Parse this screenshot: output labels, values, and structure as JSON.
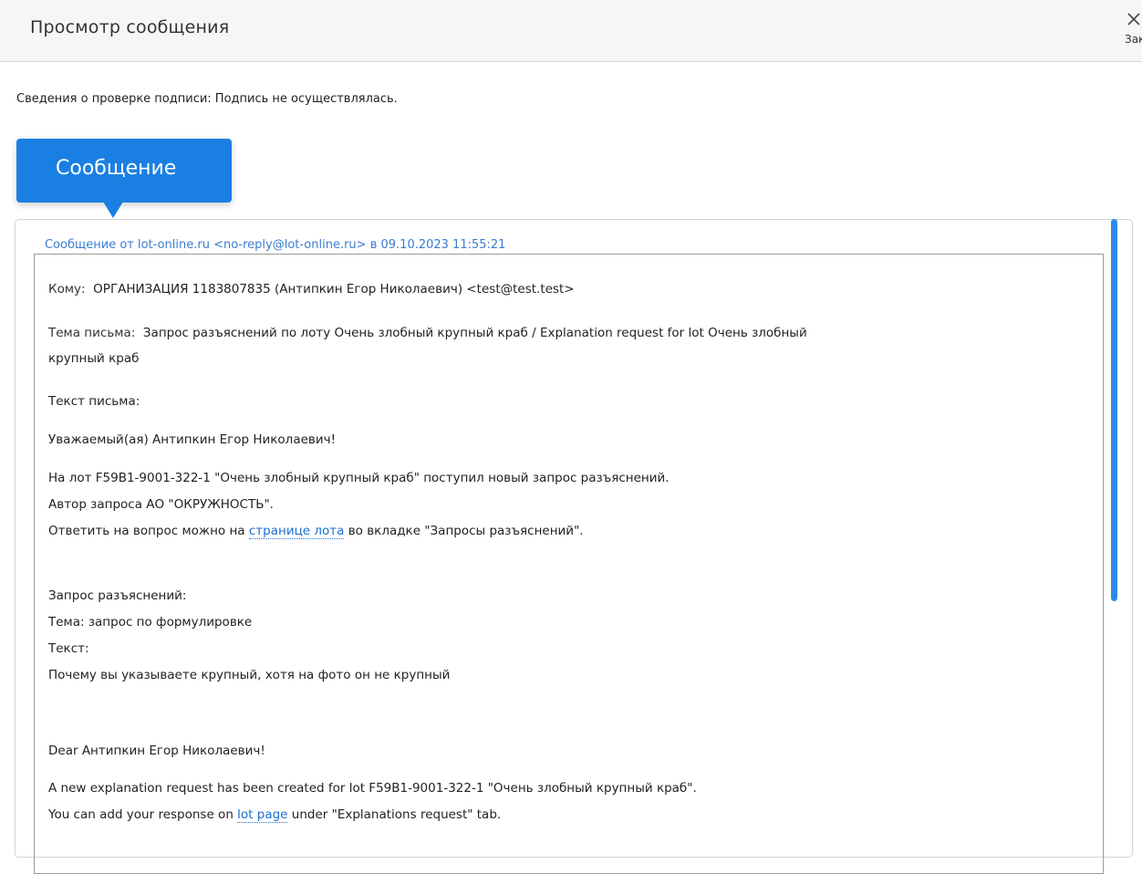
{
  "header": {
    "title": "Просмотр сообщения",
    "close_label": "Закрыть"
  },
  "signature_info": "Сведения о проверке подписи: Подпись не осуществлялась.",
  "tab": {
    "label": "Сообщение"
  },
  "message": {
    "legend": "Сообщение от lot-online.ru <no-reply@lot-online.ru> в 09.10.2023 11:55:21",
    "to_label": "Кому:",
    "to_value": "ОРГАНИЗАЦИЯ 1183807835 (Антипкин Егор Николаевич) <test@test.test>",
    "subject_label": "Тема письма:",
    "subject_value_line1": "Запрос разъяснений по лоту Очень злобный крупный краб / Explanation request for lot Очень злобный",
    "subject_value_line2": "крупный краб",
    "body_label": "Текст письма:",
    "greeting_ru": "Уважаемый(ая) Антипкин Егор Николаевич!",
    "ru_line1": "На лот F59B1-9001-322-1 \"Очень злобный крупный краб\" поступил новый запрос разъяснений.",
    "ru_line2": "Автор запроса АО \"ОКРУЖНОСТЬ\".",
    "ru_line3_before": "Ответить на вопрос можно на ",
    "ru_line3_link": "странице лота",
    "ru_line3_after": " во вкладке \"Запросы разъяснений\".",
    "req_header": "Запрос разъяснений:",
    "req_topic": "Тема: запрос по формулировке",
    "req_text_label": "Текст:",
    "req_text": "Почему вы указываете крупный, хотя на фото он не крупный",
    "greeting_en": "Dear Антипкин Егор Николаевич!",
    "en_line1": "A new explanation request has been created for lot F59B1-9001-322-1 \"Очень злобный крупный краб\".",
    "en_line2_before": "You can add your response on ",
    "en_line2_link": "lot page",
    "en_line2_after": " under \"Explanations request\" tab."
  },
  "colors": {
    "accent": "#1a7fe3",
    "link": "#1a6fd0",
    "legend": "#3a7ccf",
    "scrollbar": "#2b8ce6"
  }
}
